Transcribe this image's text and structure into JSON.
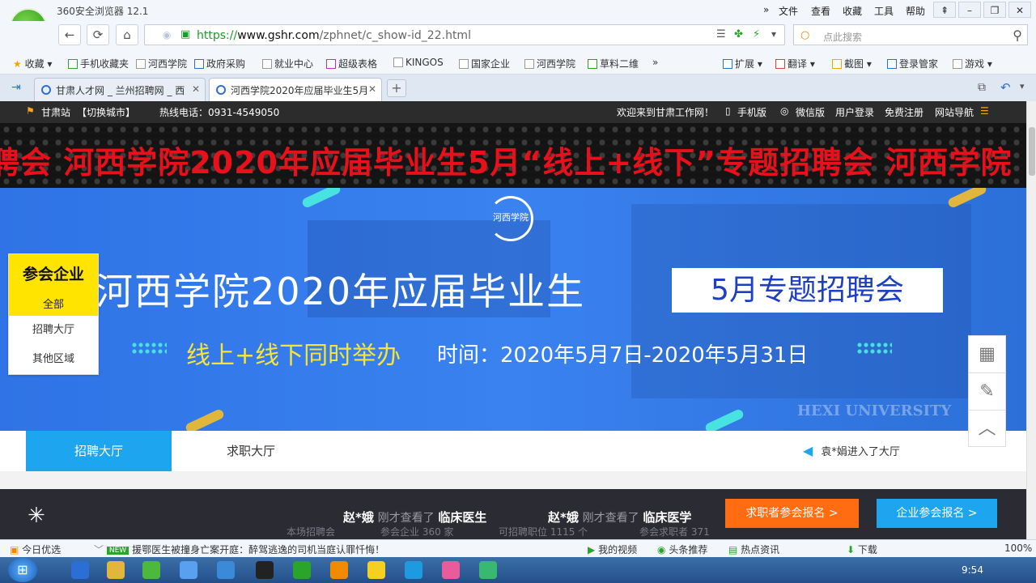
{
  "browser": {
    "app_title": "360安全浏览器 12.1",
    "menu": [
      "文件",
      "查看",
      "收藏",
      "工具",
      "帮助"
    ],
    "address": {
      "scheme": "https://",
      "host": "www.gshr.com",
      "path": "/zphnet/c_show-id_22.html"
    },
    "search_placeholder": "点此搜索",
    "bookmarks": [
      "收藏",
      "手机收藏夹",
      "河西学院",
      "政府采购",
      "就业中心",
      "超级表格",
      "KINGOS",
      "国家企业",
      "河西学院",
      "草料二维"
    ],
    "bookmarks_right": [
      "扩展",
      "翻译",
      "截图",
      "登录管家",
      "游戏"
    ],
    "tabs": [
      {
        "label": "甘肃人才网 _ 兰州招聘网 _ 西",
        "active": false
      },
      {
        "label": "河西学院2020年应届毕业生5月",
        "active": true
      }
    ]
  },
  "topbar": {
    "station": "甘肃站",
    "switch_city": "【切换城市】",
    "hotline": "热线电话：0931-4549050",
    "welcome": "欢迎来到甘肃工作网！",
    "mobile": "手机版",
    "wechat": "微信版",
    "login": "用户登录",
    "register": "免费注册",
    "nav": "网站导航"
  },
  "marquee": "聘会 河西学院2020年应届毕业生5月“线上+线下”专题招聘会 河西学院",
  "banner": {
    "logo_text": "河西学院",
    "title": "河西学院2020年应届毕业生",
    "badge": "5月专题招聘会",
    "subtitle": "线上+线下同时举办",
    "time": "时间：2020年5月7日-2020年5月31日",
    "building_text": "HEXI UNIVERSITY"
  },
  "company_box": {
    "title": "参会企业",
    "all": "全部",
    "items": [
      "招聘大厅",
      "其他区域"
    ]
  },
  "main_tabs": {
    "recruit": "招聘大厅",
    "job": "求职大厅",
    "notice": "袁*娟进入了大厅"
  },
  "dark_bar": {
    "viewers": [
      {
        "name": "赵*娥",
        "action": "刚才查看了",
        "job": "临床医生"
      },
      {
        "name": "赵*娥",
        "action": "刚才查看了",
        "job": "临床医学"
      }
    ],
    "stats": [
      "本场招聘会",
      "参会企业 360 家",
      "可招聘职位 1115 个",
      "参会求职者 371"
    ],
    "seeker_btn": "求职者参会报名 >",
    "company_btn": "企业参会报名 >"
  },
  "statusbar": {
    "left": "今日优选",
    "news": "援鄂医生被撞身亡案开庭：醉驾逃逸的司机当庭认罪忏悔！",
    "right": [
      "我的视频",
      "头条推荐",
      "热点资讯",
      "下载"
    ],
    "zoom": "100%"
  },
  "taskbar": {
    "clock": "9:54"
  }
}
